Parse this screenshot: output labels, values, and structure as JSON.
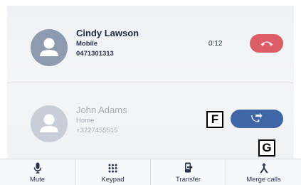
{
  "calls": [
    {
      "name": "Cindy Lawson",
      "label": "Mobile",
      "number": "0471301313",
      "duration": "0:12",
      "action_icon": "end-call-icon",
      "action_color": "#dc5c68"
    },
    {
      "name": "John Adams",
      "label": "Home",
      "number": "+3227455515",
      "action_icon": "swap-call-icon",
      "action_color": "#3f67a8"
    }
  ],
  "callouts": {
    "f": "F",
    "g": "G"
  },
  "toolbar": {
    "items": [
      {
        "label": "Mute",
        "icon": "microphone-icon"
      },
      {
        "label": "Keypad",
        "icon": "keypad-icon"
      },
      {
        "label": "Transfer",
        "icon": "transfer-icon"
      },
      {
        "label": "Merge calls",
        "icon": "merge-calls-icon"
      }
    ]
  },
  "colors": {
    "text_primary": "#1e2a44",
    "text_inactive": "#a6adb8",
    "accent": "#3f67a8",
    "end_call": "#dc5c68"
  }
}
